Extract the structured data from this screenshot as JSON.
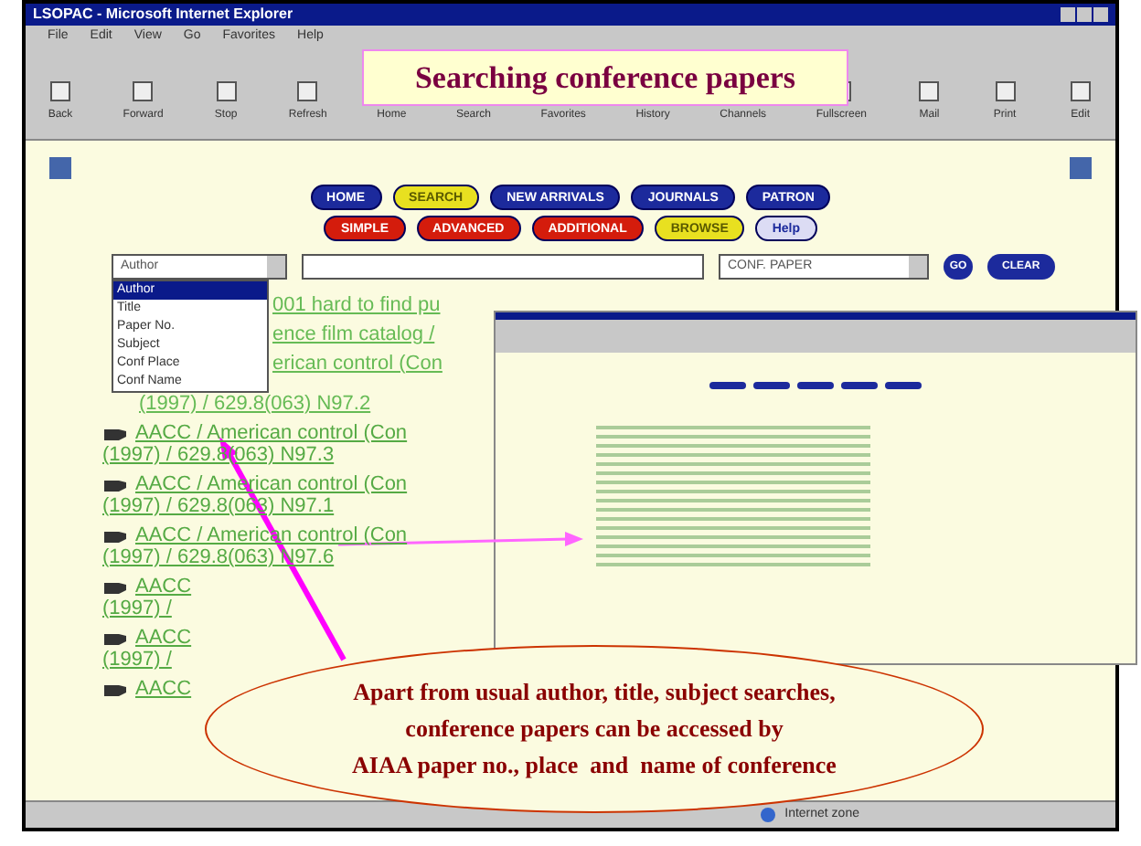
{
  "window": {
    "title": "LSOPAC - Microsoft Internet Explorer"
  },
  "menu": [
    "File",
    "Edit",
    "View",
    "Go",
    "Favorites",
    "Help"
  ],
  "toolbar": [
    "Back",
    "Forward",
    "Stop",
    "Refresh",
    "Home",
    "Search",
    "Favorites",
    "History",
    "Channels",
    "Fullscreen",
    "Mail",
    "Print",
    "Edit"
  ],
  "slide_title": "Searching conference papers",
  "nav_row_1": [
    {
      "label": "HOME",
      "selected": false
    },
    {
      "label": "SEARCH",
      "selected": true
    },
    {
      "label": "NEW ARRIVALS",
      "selected": false
    },
    {
      "label": "JOURNALS",
      "selected": false
    },
    {
      "label": "PATRON",
      "selected": false
    }
  ],
  "nav_row_2": [
    {
      "label": "SIMPLE",
      "selected": false
    },
    {
      "label": "ADVANCED",
      "selected": false
    },
    {
      "label": "ADDITIONAL",
      "selected": false
    },
    {
      "label": "BROWSE",
      "selected": true
    },
    {
      "label": "Help",
      "selected": false
    }
  ],
  "search": {
    "field_select": "Author",
    "options": [
      {
        "label": "Author",
        "selected": true
      },
      {
        "label": "Title",
        "selected": false
      },
      {
        "label": "Paper No.",
        "selected": false
      },
      {
        "label": "Subject",
        "selected": false
      },
      {
        "label": "Conf Place",
        "selected": false
      },
      {
        "label": "Conf Name",
        "selected": false
      }
    ],
    "type_select": "CONF. PAPER",
    "go": "GO",
    "clear": "CLEAR"
  },
  "partial_results": [
    "001 hard to find pu",
    "ence film catalog /",
    "erican control (Con"
  ],
  "partial_result_tail": "(1997) / 629.8(063) N97.2",
  "results": [
    {
      "title": "AACC / American control (Con",
      "call_no": "(1997) / 629.8(063) N97.3"
    },
    {
      "title": "AACC / American control (Con",
      "call_no": "(1997) / 629.8(063) N97.1"
    },
    {
      "title": "AACC / American control (Con",
      "call_no": "(1997) / 629.8(063) N97.6"
    },
    {
      "title": "AACC",
      "call_no": "(1997) /"
    },
    {
      "title": "AACC",
      "call_no": "(1997) /"
    },
    {
      "title": "AACC"
    }
  ],
  "status_bar": {
    "zone": "Internet zone"
  },
  "callout": [
    "Apart from usual author, title, subject searches,",
    "conference papers can be accessed by",
    "AIAA paper no., place  and  name of conference"
  ]
}
